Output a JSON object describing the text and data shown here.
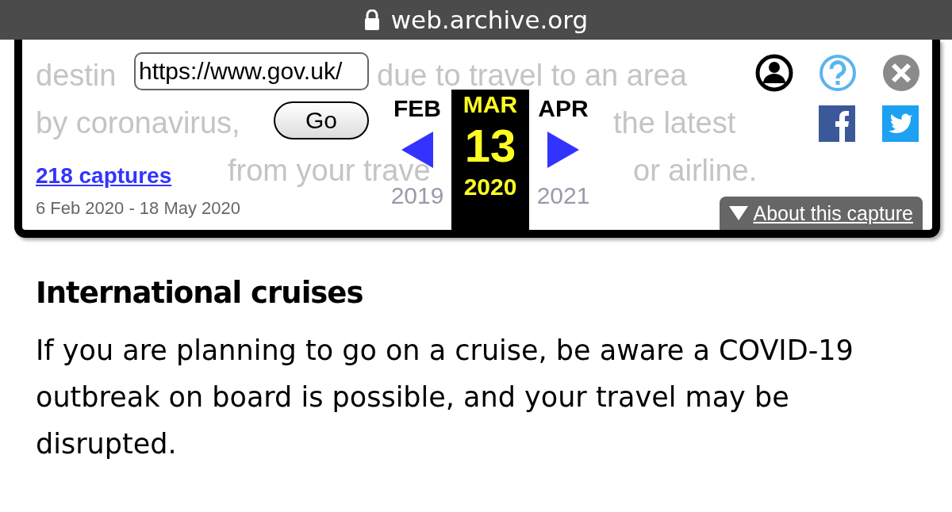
{
  "address_bar": {
    "host": "web.archive.org"
  },
  "page_behind": {
    "fragments": [
      {
        "text": "destin"
      },
      {
        "text": "due to travel to an area"
      },
      {
        "text": "by coronavirus,"
      },
      {
        "text": "the latest"
      },
      {
        "text": "from your trave"
      },
      {
        "text": "or airline."
      }
    ]
  },
  "wayback_toolbar": {
    "url_field": {
      "value": "https://www.gov.uk/"
    },
    "go_button": "Go",
    "captures_link": "218 captures",
    "date_range": "6 Feb 2020 - 18 May 2020",
    "calendar": {
      "day": "13",
      "columns": [
        {
          "month": "FEB",
          "year": "2019",
          "selected": false
        },
        {
          "month": "MAR",
          "year": "2020",
          "selected": true
        },
        {
          "month": "APR",
          "year": "2021",
          "selected": false
        }
      ]
    },
    "about_button": "About this capture"
  },
  "article": {
    "heading": "International cruises",
    "paragraph": "If you are planning to go on a cruise, be aware a COVID-19 outbreak on board is possible, and your travel may be disrupted."
  }
}
